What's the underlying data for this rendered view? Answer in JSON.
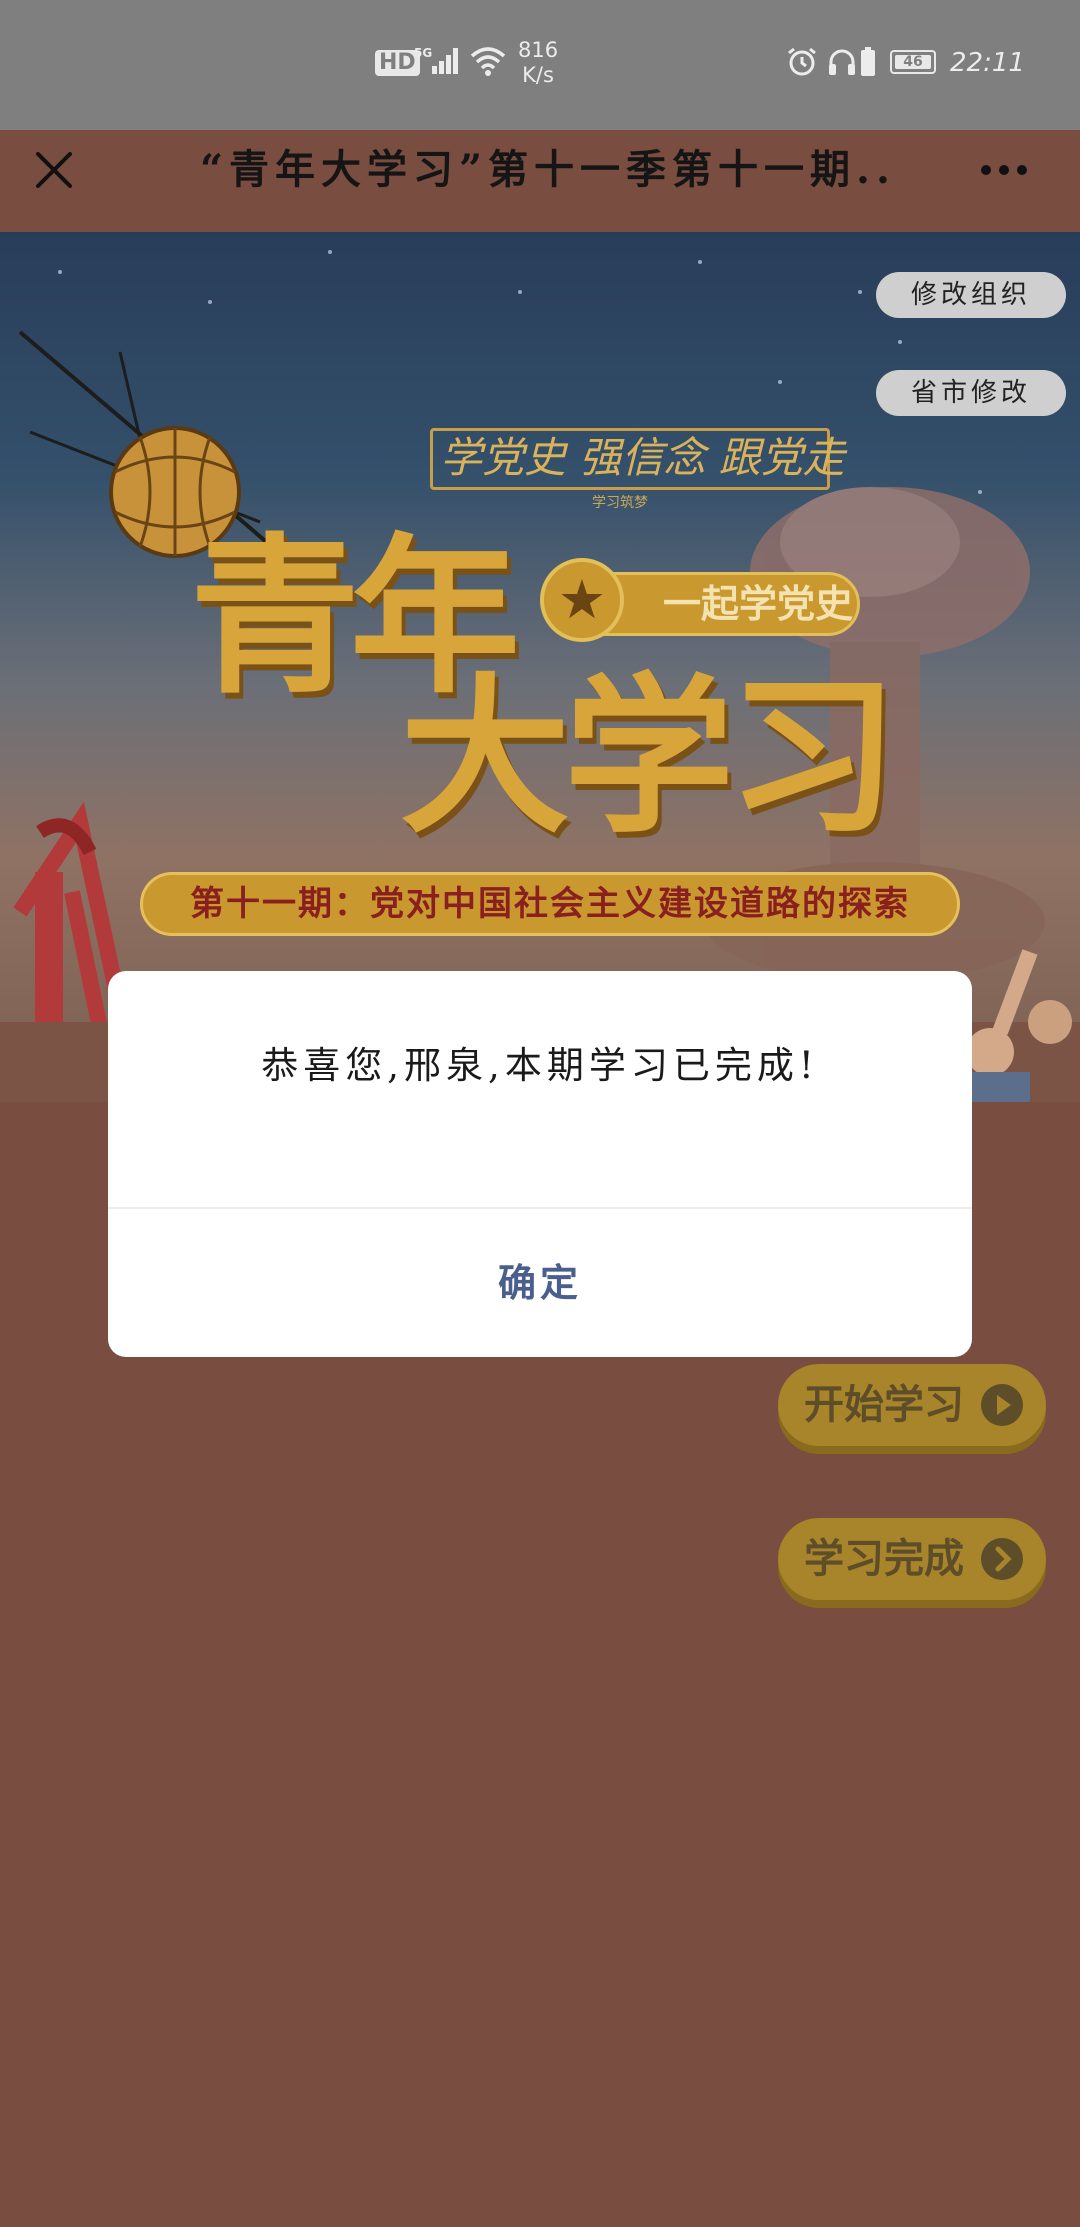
{
  "status_bar": {
    "hd_label": "HD",
    "network_label": "5G",
    "net_speed": "816",
    "net_speed_unit": "K/s",
    "battery_level": "46",
    "time": "22:11"
  },
  "nav": {
    "title": "“青年大学习”第十一季第十一期.."
  },
  "banner": {
    "slogan": "学党史 强信念 跟党走",
    "slogan_small": "学习筑梦",
    "logo_line1": "青年",
    "logo_line2": "大学习",
    "badge": "一起学党史",
    "subtitle": "第十一期：党对中国社会主义建设道路的探索",
    "modify_org_button": "修改组织",
    "modify_province_button": "省市修改"
  },
  "actions": {
    "start_label": "开始学习",
    "done_label": "学习完成"
  },
  "dialog": {
    "message": "恭喜您,邢泉,本期学习已完成!",
    "ok_label": "确定"
  },
  "colors": {
    "page_background": "#7a4d41",
    "status_bar": "#7f7f7f",
    "dialog_button_text": "#4a5f8e",
    "action_button": "#a8842a"
  }
}
